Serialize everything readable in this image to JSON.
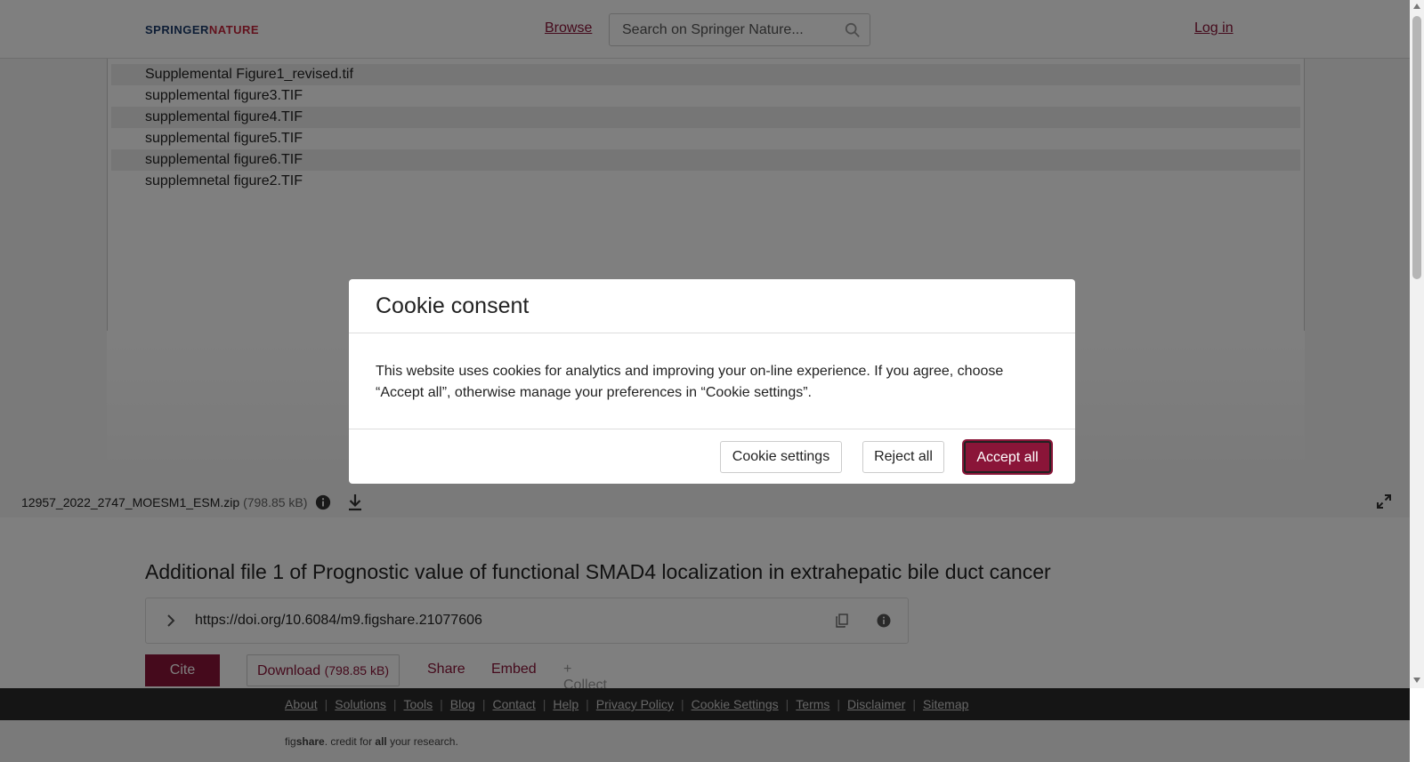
{
  "header": {
    "logo_part1": "SPRINGER",
    "logo_part2": "NATURE",
    "browse_label": "Browse",
    "search_placeholder": "Search on Springer Nature...",
    "login_label": "Log in"
  },
  "preview": {
    "files": [
      "Supplemental Figure1_revised.tif",
      "supplemental figure3.TIF",
      "supplemental figure4.TIF",
      "supplemental figure5.TIF",
      "supplemental figure6.TIF",
      "supplemnetal figure2.TIF"
    ]
  },
  "file_bar": {
    "file_name": "12957_2022_2747_MOESM1_ESM.zip",
    "file_size": "(798.85 kB)"
  },
  "item": {
    "title": "Additional file 1 of Prognostic value of functional SMAD4 localization in extrahepatic bile duct cancer",
    "doi": "https://doi.org/10.6084/m9.figshare.21077606",
    "cite_label": "Cite",
    "download_label": "Download",
    "download_size": "(798.85 kB)",
    "share_label": "Share",
    "embed_label": "Embed",
    "collect_label": "+ Collect"
  },
  "footer": {
    "links": [
      "About",
      "Solutions",
      "Tools",
      "Blog",
      "Contact",
      "Help",
      "Privacy Policy",
      "Cookie Settings",
      "Terms",
      "Disclaimer",
      "Sitemap"
    ],
    "tagline_fig": "fig",
    "tagline_share": "share",
    "tagline_mid": ". credit for ",
    "tagline_all": "all",
    "tagline_end": " your research."
  },
  "cookie_modal": {
    "title": "Cookie consent",
    "body": "This website uses cookies for analytics and improving your on-line experience. If you agree, choose “Accept all”, otherwise manage your preferences in “Cookie settings”.",
    "settings_label": "Cookie settings",
    "reject_label": "Reject all",
    "accept_label": "Accept all"
  },
  "colors": {
    "accent": "#8a1538",
    "footer_bg": "#2b2b2b",
    "overlay": "rgba(0,0,0,0.5)"
  }
}
